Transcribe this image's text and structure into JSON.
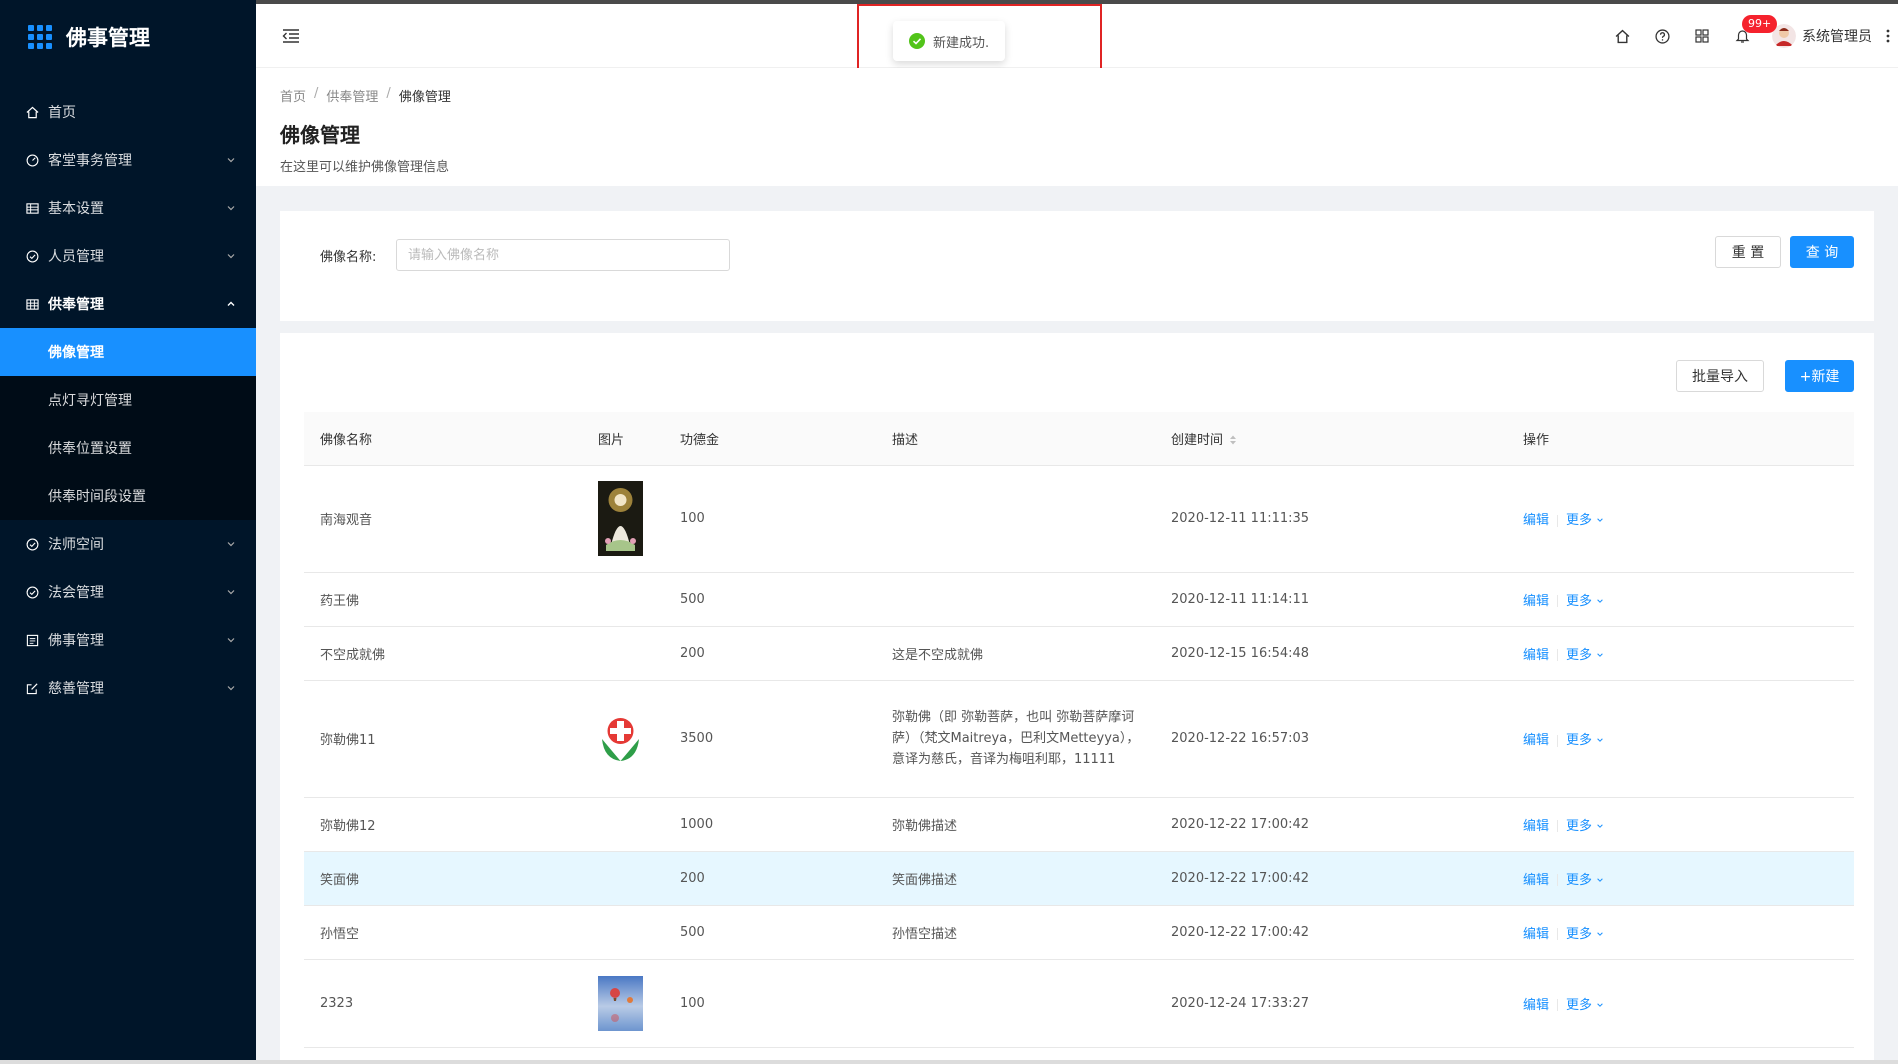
{
  "app": {
    "title": "佛事管理"
  },
  "sidebar": {
    "items": [
      {
        "label": "首页",
        "icon": "home-icon",
        "has_children": false
      },
      {
        "label": "客堂事务管理",
        "icon": "dashboard-icon",
        "has_children": true
      },
      {
        "label": "基本设置",
        "icon": "table-icon",
        "has_children": true
      },
      {
        "label": "人员管理",
        "icon": "check-circle-icon",
        "has_children": true
      },
      {
        "label": "供奉管理",
        "icon": "table-icon",
        "has_children": true,
        "open": true,
        "children": [
          {
            "label": "佛像管理",
            "active": true
          },
          {
            "label": "点灯寻灯管理"
          },
          {
            "label": "供奉位置设置"
          },
          {
            "label": "供奉时间段设置"
          }
        ]
      },
      {
        "label": "法师空间",
        "icon": "check-circle-icon",
        "has_children": true
      },
      {
        "label": "法会管理",
        "icon": "check-circle-icon",
        "has_children": true
      },
      {
        "label": "佛事管理",
        "icon": "profile-icon",
        "has_children": true
      },
      {
        "label": "慈善管理",
        "icon": "form-icon",
        "has_children": true
      }
    ]
  },
  "header": {
    "badge": "99+",
    "username": "系统管理员"
  },
  "toast": {
    "message": "新建成功."
  },
  "page": {
    "breadcrumb": [
      "首页",
      "供奉管理",
      "佛像管理"
    ],
    "title": "佛像管理",
    "description": "在这里可以维护佛像管理信息"
  },
  "search": {
    "label": "佛像名称:",
    "placeholder": "请输入佛像名称",
    "value": "",
    "reset_label": "重 置",
    "query_label": "查 询"
  },
  "toolbar": {
    "import_label": "批量导入",
    "new_label": "+新建"
  },
  "table": {
    "columns": [
      "佛像名称",
      "图片",
      "功德金",
      "描述",
      "创建时间",
      "操作"
    ],
    "edit_label": "编辑",
    "more_label": "更多",
    "rows": [
      {
        "name": "南海观音",
        "image": "guanyin-image",
        "amount": "100",
        "desc": "",
        "created": "2020-12-11 11:11:35"
      },
      {
        "name": "药王佛",
        "image": "",
        "amount": "500",
        "desc": "",
        "created": "2020-12-11 11:14:11"
      },
      {
        "name": "不空成就佛",
        "image": "",
        "amount": "200",
        "desc": "这是不空成就佛",
        "created": "2020-12-15 16:54:48"
      },
      {
        "name": "弥勒佛11",
        "image": "red-cross-logo-image",
        "amount": "3500",
        "desc": "弥勒佛（即 弥勒菩萨，也叫 弥勒菩萨摩诃萨）（梵文Maitreya，巴利文Metteyya），意译为慈氏，音译为梅咀利耶，11111",
        "created": "2020-12-22 16:57:03"
      },
      {
        "name": "弥勒佛12",
        "image": "",
        "amount": "1000",
        "desc": "弥勒佛描述",
        "created": "2020-12-22 17:00:42"
      },
      {
        "name": "笑面佛",
        "image": "",
        "amount": "200",
        "desc": "笑面佛描述",
        "created": "2020-12-22 17:00:42",
        "highlight": true
      },
      {
        "name": "孙悟空",
        "image": "",
        "amount": "500",
        "desc": "孙悟空描述",
        "created": "2020-12-22 17:00:42"
      },
      {
        "name": "2323",
        "image": "balloon-sky-image",
        "amount": "100",
        "desc": "",
        "created": "2020-12-24 17:33:27"
      }
    ]
  },
  "colors": {
    "sidebar_bg": "#001529",
    "primary": "#1890ff",
    "success": "#52c41a",
    "danger": "#f5222d"
  }
}
